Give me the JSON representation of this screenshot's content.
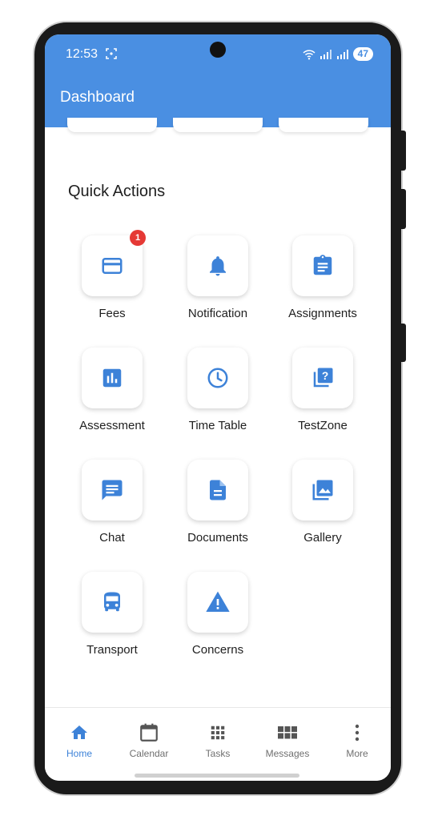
{
  "status": {
    "time": "12:53",
    "battery": "47"
  },
  "header": {
    "title": "Dashboard"
  },
  "quick_actions": {
    "title": "Quick Actions",
    "items": [
      {
        "label": "Fees",
        "icon": "card-icon",
        "badge": "1"
      },
      {
        "label": "Notification",
        "icon": "bell-icon"
      },
      {
        "label": "Assignments",
        "icon": "clipboard-icon"
      },
      {
        "label": "Assessment",
        "icon": "bar-chart-icon"
      },
      {
        "label": "Time Table",
        "icon": "clock-icon"
      },
      {
        "label": "TestZone",
        "icon": "quiz-icon"
      },
      {
        "label": "Chat",
        "icon": "chat-icon"
      },
      {
        "label": "Documents",
        "icon": "document-icon"
      },
      {
        "label": "Gallery",
        "icon": "gallery-icon"
      },
      {
        "label": "Transport",
        "icon": "bus-icon"
      },
      {
        "label": "Concerns",
        "icon": "warning-icon"
      }
    ]
  },
  "bottom_nav": {
    "items": [
      {
        "label": "Home",
        "icon": "home-icon",
        "active": true
      },
      {
        "label": "Calendar",
        "icon": "calendar-icon"
      },
      {
        "label": "Tasks",
        "icon": "grid-icon"
      },
      {
        "label": "Messages",
        "icon": "messages-grid-icon"
      },
      {
        "label": "More",
        "icon": "more-vertical-icon"
      }
    ]
  },
  "colors": {
    "primary": "#4a8fe2",
    "icon": "#3d82d8",
    "badge": "#e53935"
  }
}
